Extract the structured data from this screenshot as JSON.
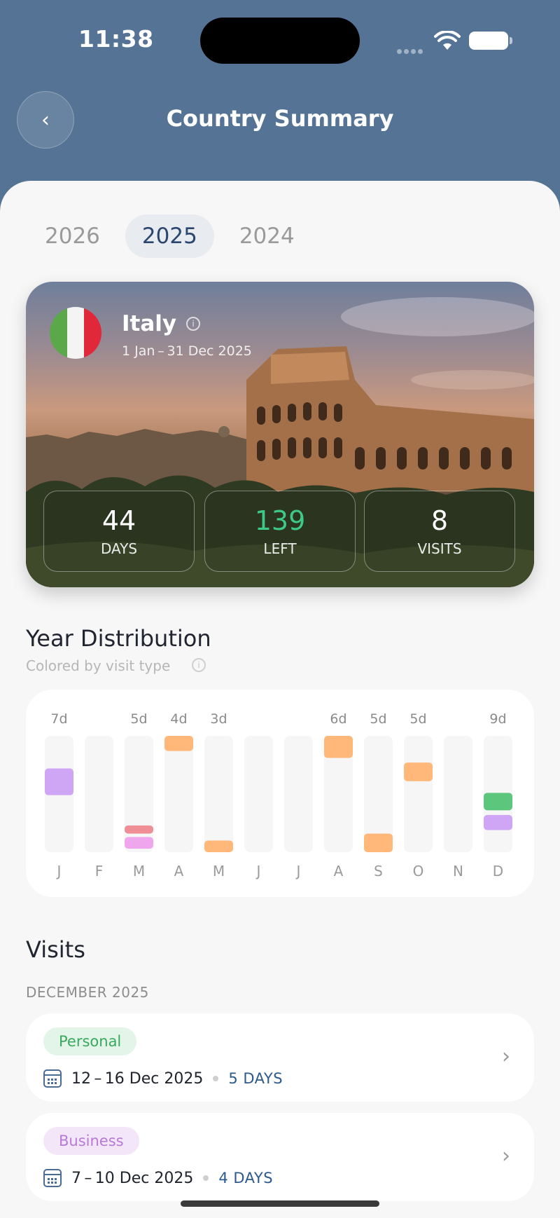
{
  "status_bar": {
    "time": "11:38"
  },
  "header": {
    "title": "Country Summary"
  },
  "year_tabs": [
    {
      "label": "2026",
      "active": false
    },
    {
      "label": "2025",
      "active": true
    },
    {
      "label": "2024",
      "active": false
    }
  ],
  "country": {
    "name": "Italy",
    "date_range": "1 Jan – 31 Dec 2025",
    "stats": [
      {
        "value": "44",
        "label": "DAYS"
      },
      {
        "value": "139",
        "label": "LEFT"
      },
      {
        "value": "8",
        "label": "VISITS"
      }
    ]
  },
  "distribution": {
    "title": "Year Distribution",
    "subtitle": "Colored by visit type"
  },
  "chart_data": {
    "type": "bar",
    "categories": [
      "J",
      "F",
      "M",
      "A",
      "M",
      "J",
      "J",
      "A",
      "S",
      "O",
      "N",
      "D"
    ],
    "labels": [
      "7d",
      "",
      "5d",
      "4d",
      "3d",
      "",
      "",
      "6d",
      "5d",
      "5d",
      "",
      "9d"
    ],
    "segments": [
      [
        {
          "start": 0.49,
          "end": 0.72,
          "type": "Business"
        }
      ],
      [],
      [
        {
          "start": 0.03,
          "end": 0.13,
          "type": "Business-pink"
        },
        {
          "start": 0.16,
          "end": 0.23,
          "type": "Red"
        }
      ],
      [
        {
          "start": 0.87,
          "end": 1.0,
          "type": "Orange"
        }
      ],
      [
        {
          "start": 0.0,
          "end": 0.1,
          "type": "Orange"
        }
      ],
      [],
      [],
      [
        {
          "start": 0.81,
          "end": 1.0,
          "type": "Orange"
        }
      ],
      [
        {
          "start": 0.0,
          "end": 0.16,
          "type": "Orange"
        }
      ],
      [
        {
          "start": 0.61,
          "end": 0.77,
          "type": "Orange"
        }
      ],
      [],
      [
        {
          "start": 0.19,
          "end": 0.32,
          "type": "Business"
        },
        {
          "start": 0.36,
          "end": 0.51,
          "type": "Personal"
        }
      ]
    ],
    "colors": {
      "Business": "#cfa6f5",
      "Business-pink": "#f0a6ec",
      "Red": "#ef8f95",
      "Orange": "#ffb77a",
      "Personal": "#5cc77c",
      "track": "#f6f6f6",
      "month_label": "#9a9a9a",
      "top_label": "#8a8a8a"
    }
  },
  "visits": {
    "title": "Visits",
    "month": "DECEMBER 2025",
    "items": [
      {
        "type": "Personal",
        "dates": "12 – 16 Dec 2025",
        "days": "5 DAYS"
      },
      {
        "type": "Business",
        "dates": "7 – 10 Dec 2025",
        "days": "4 DAYS"
      }
    ]
  }
}
